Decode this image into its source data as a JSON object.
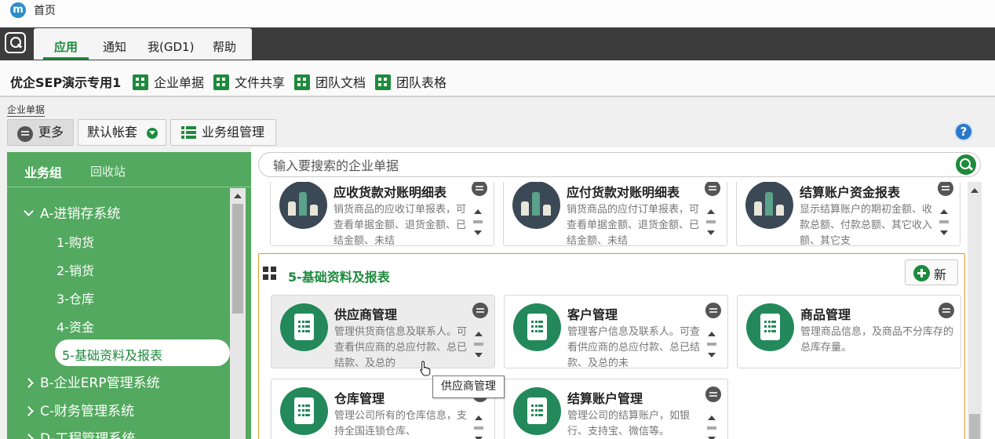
{
  "window": {
    "logo_text": "m",
    "title": "首页"
  },
  "menu": {
    "tabs": [
      "应用",
      "通知",
      "我(GD1)",
      "帮助"
    ],
    "active": "应用"
  },
  "toolbar": {
    "company": "优企SEP演示专用1",
    "items": [
      "企业单据",
      "文件共享",
      "团队文档",
      "团队表格"
    ]
  },
  "breadcrumb": "企业单据",
  "actions": {
    "more": "更多",
    "account": "默认帐套",
    "group_manage": "业务组管理",
    "help": "?"
  },
  "sidebar": {
    "tabs": [
      "业务组",
      "回收站"
    ],
    "tree": {
      "a": "A-进销存系统",
      "a_children": [
        "1-购货",
        "2-销货",
        "3-仓库",
        "4-资金",
        "5-基础资料及报表"
      ],
      "b": "B-企业ERP管理系统",
      "c": "C-财务管理系统",
      "d": "D-工程管理系统"
    }
  },
  "search": {
    "placeholder": "输入要搜索的企业单据"
  },
  "top_cards": [
    {
      "title": "应收货款对账明细表",
      "desc": "销货商品的应收订单报表，可查看单据金额、退货金额、已结金额、未结"
    },
    {
      "title": "应付货款对账明细表",
      "desc": "销货商品的应付订单报表，可查看单据金额、退货金额、已结金额、未结"
    },
    {
      "title": "结算账户资金报表",
      "desc": "显示结算账户的期初金额、收款总额、付款总额、其它收入额、其它支"
    }
  ],
  "section": {
    "title": "5-基础资料及报表",
    "new_label": "新",
    "cards": [
      {
        "title": "供应商管理",
        "desc": "管理供货商信息及联系人。可查看供应商的总应付款、总已结款、及总的"
      },
      {
        "title": "客户管理",
        "desc": "管理客户信息及联系人。可查看供应商的总应付款、总已结款、及总的未"
      },
      {
        "title": "商品管理",
        "desc": "管理商品信息，及商品不分库存的总库存量。"
      },
      {
        "title": "仓库管理",
        "desc": "管理公司所有的仓库信息，支持全国连锁仓库、"
      },
      {
        "title": "结算账户管理",
        "desc": "管理公司的结算账户，如银行、支持宝、微信等。"
      }
    ]
  },
  "tooltip": "供应商管理",
  "colors": {
    "brand_green": "#1e8a3c",
    "sidebar_green": "#53a95f",
    "section_border": "#d79a2f",
    "menubar": "#3c3c3c"
  }
}
